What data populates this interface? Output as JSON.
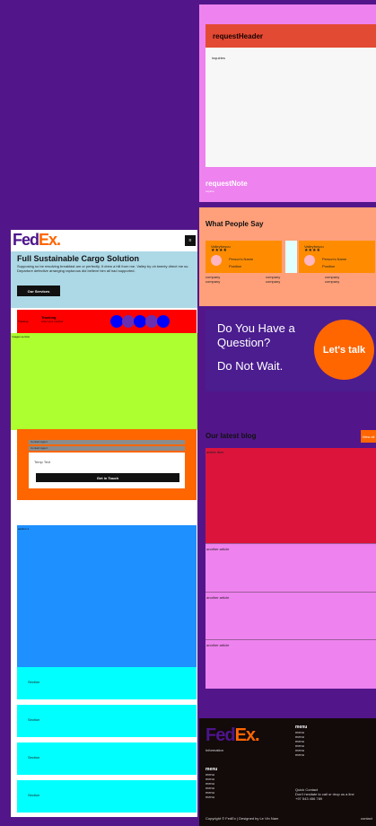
{
  "request": {
    "header": "requestHeader",
    "body_text": "inquiries",
    "note": "requestNote",
    "note_sub": "explore"
  },
  "testimonials": {
    "title": "What People Say",
    "cards": [
      {
        "user": "Valleyforyou",
        "stars": "★★★★",
        "name": "Person's Name",
        "position": "Position"
      },
      {
        "user": "Valleyforyou",
        "stars": "★★★★",
        "name": "Person's Name",
        "position": "Position"
      }
    ],
    "companies": [
      [
        "company",
        "company",
        "company"
      ],
      [
        "company",
        "company",
        "company"
      ]
    ]
  },
  "cta": {
    "line1": "Do You Have a Question?",
    "line2": "Do Not Wait.",
    "button": "Let's talk"
  },
  "blog": {
    "title": "Our latest blog",
    "view_all": "View all",
    "featured_label": "article item",
    "articles": [
      "another article",
      "another article",
      "another article"
    ]
  },
  "footer": {
    "logo_fed": "Fed",
    "logo_ex": "Ex",
    "logo_dot": ".",
    "information": "Information",
    "menu1_title": "menu",
    "menu1_items": [
      "menu",
      "menu",
      "menu",
      "menu",
      "menu",
      "menu"
    ],
    "menu2_title": "menu",
    "menu2_items": [
      "menu",
      "menu",
      "menu",
      "menu",
      "menu",
      "menu"
    ],
    "contact_title": "Quick Contact",
    "contact_text": "Don't hesitate to call or drop us a line",
    "phone": "+97 543 456 789",
    "copyright": "Copyright © FedEx | Designed by Le Vin Nam",
    "corner": "contact"
  },
  "header": {
    "logo_fed": "Fed",
    "logo_ex": "Ex",
    "logo_dot": ".",
    "menu_icon": "menu-icon"
  },
  "hero": {
    "title": "Full Sustainable Cargo Solution",
    "text": "Supposing so be resolving breakfast am or perfectly. It drew a hill from me. Valley by oh twenty direct me so. Departure defective arranging rapturous did believe him all had supported.",
    "button": "Our Services"
  },
  "tracking": {
    "label": "Tracking",
    "title": "Tracking",
    "sub": "enter your number"
  },
  "section_label": "Images service",
  "contact": {
    "bar1": "Contact Agent",
    "bar2": "Contact Agent",
    "placeholder": "Temp Text",
    "button": "Get in Touch"
  },
  "blue_label": "section 1",
  "cyan_labels": [
    "Section",
    "Section",
    "Section",
    "Section"
  ],
  "colors": {
    "purple": "#53168a",
    "fedex_purple": "#4d148c",
    "fedex_orange": "#ff6600"
  }
}
